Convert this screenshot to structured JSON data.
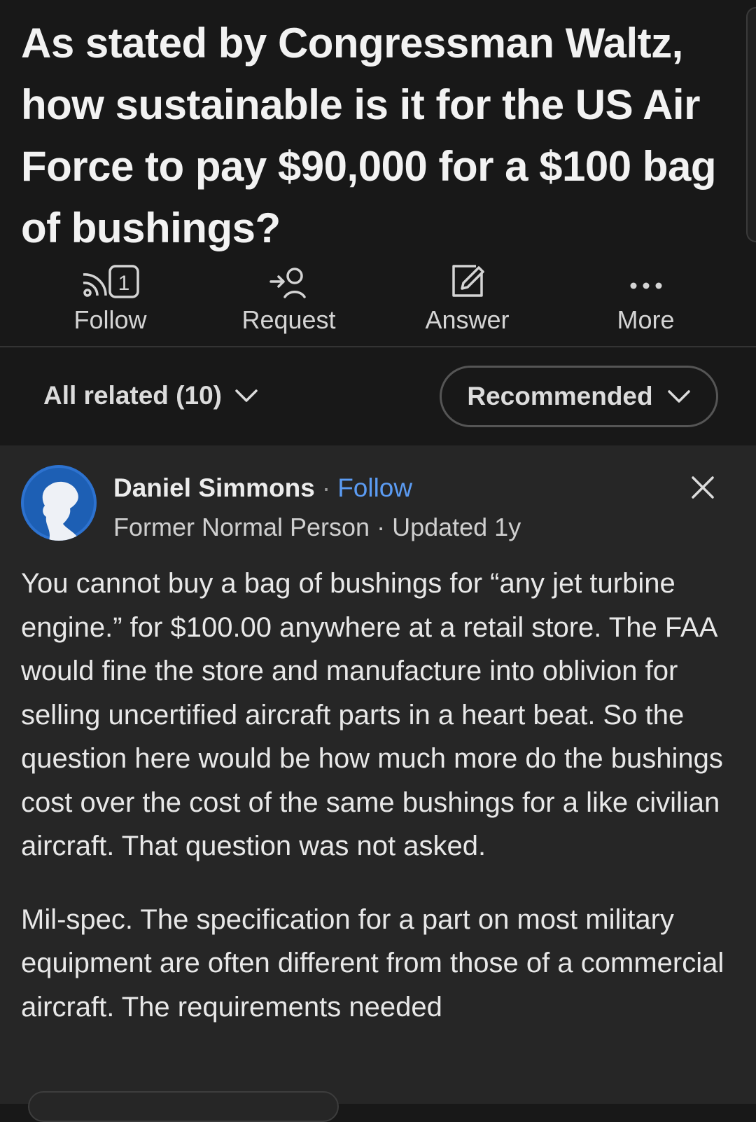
{
  "question": {
    "title": "As stated by Congressman Waltz, how sustainable is it for the US Air Force to pay $90,000 for a $100 bag of bushings?"
  },
  "actions": {
    "follow": {
      "label": "Follow",
      "badge": "1",
      "icon": "rss-follow-icon"
    },
    "request": {
      "label": "Request",
      "icon": "request-person-icon"
    },
    "answer": {
      "label": "Answer",
      "icon": "pencil-answer-icon"
    },
    "more": {
      "label": "More",
      "icon": "ellipsis-icon"
    }
  },
  "filters": {
    "related_label": "All related (10)",
    "sort_label": "Recommended"
  },
  "answer": {
    "author_name": "Daniel Simmons",
    "separator": "·",
    "follow_label": "Follow",
    "author_meta": "Former Normal Person · Updated 1y",
    "paragraphs": [
      "You cannot buy a bag of bushings for “any jet turbine engine.” for $100.00 anywhere at a retail store. The FAA would fine the store and manufacture into oblivion for selling uncertified aircraft parts in a heart beat. So the question here would be how much more do the bushings cost over the cost of the same bushings for a like civilian aircraft. That question was not asked.",
      "Mil-spec. The specification for a part on most military equipment are often different from those of a commercial aircraft. The requirements needed"
    ]
  },
  "colors": {
    "background": "#181818",
    "card": "#262626",
    "link": "#5b9bf2",
    "avatar": "#1d5fb4"
  }
}
